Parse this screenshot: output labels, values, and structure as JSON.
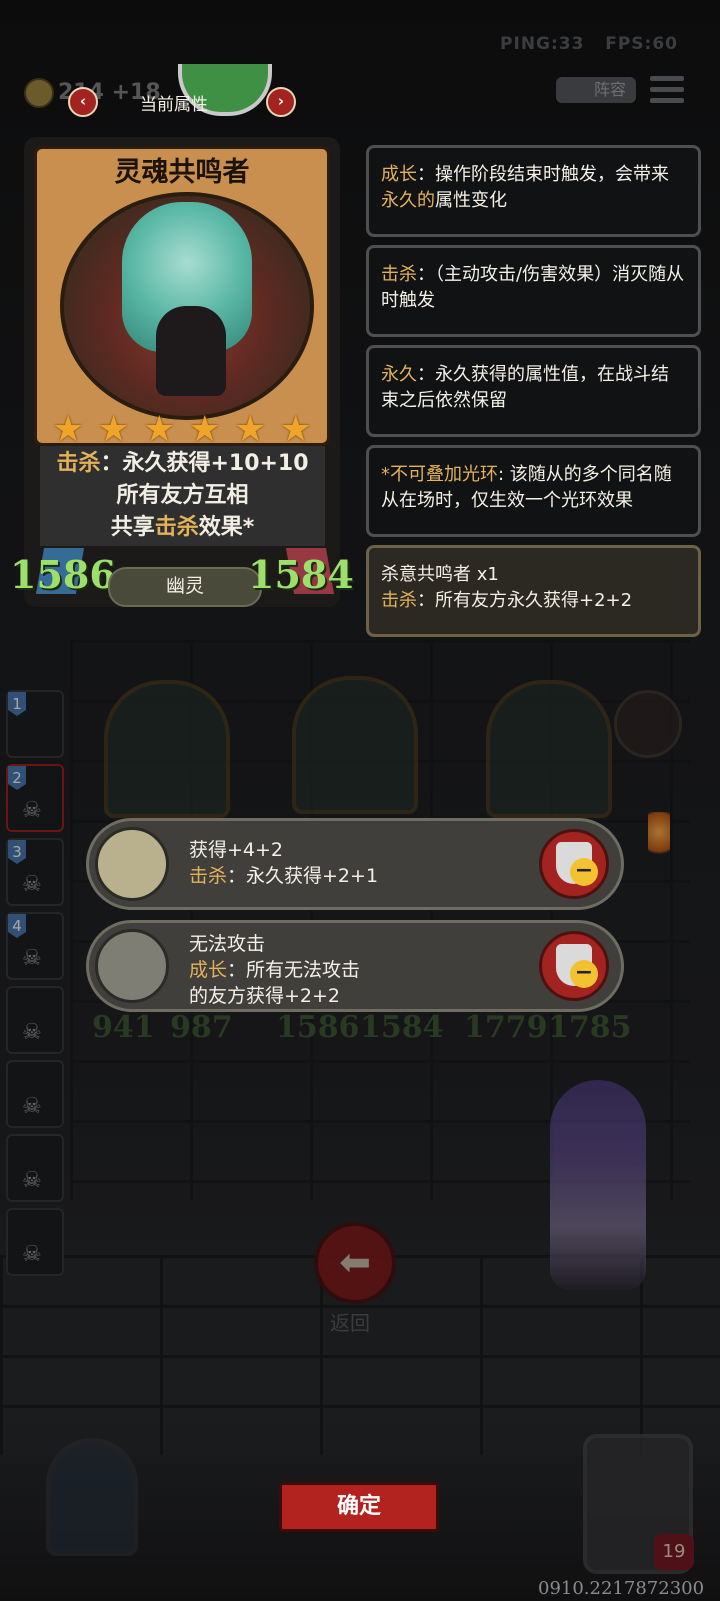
{
  "hud": {
    "ping": "PING:33",
    "fps": "FPS:60",
    "gold": "214",
    "gold_gain": "+18",
    "current_attr": "当前属性",
    "lineup_label": "阵容"
  },
  "card": {
    "name": "灵魂共鸣者",
    "stars": 6,
    "desc_line1_kw": "击杀",
    "desc_line1_rest": "：永久获得+10+10",
    "desc_line2": "所有友方互相",
    "desc_line3_pre": "共享",
    "desc_line3_kw": "击杀",
    "desc_line3_post": "效果*",
    "attack": "1586",
    "health": "1584",
    "type": "幽灵"
  },
  "tooltips": [
    {
      "kw": "成长",
      "pre": "：操作阶段结束时触发，会带来",
      "kw2": "永久的",
      "post": "属性变化"
    },
    {
      "kw": "击杀",
      "pre": "：（主动攻击/伤害效果）消灭随从时触发",
      "kw2": "",
      "post": ""
    },
    {
      "kw": "永久",
      "pre": "：永久获得的属性值，在战斗结束之后依然保留",
      "kw2": "",
      "post": ""
    },
    {
      "kw": "*不可叠加光环",
      "pre": ": 该随从的多个同名随从在场时，仅生效一个光环效果",
      "kw2": "",
      "post": ""
    }
  ],
  "bonus_tip": {
    "title": "杀意共鸣者 x1",
    "kw": "击杀",
    "text": "：所有友方永久获得+2+2"
  },
  "roster": [
    "1",
    "2",
    "3",
    "4"
  ],
  "board": {
    "row1_stats": [
      "941",
      "987",
      "1586",
      "1584",
      "1779",
      "1785"
    ]
  },
  "popups": [
    {
      "line1": "获得+4+2",
      "kw": "击杀",
      "line2": "：永久获得+2+1",
      "line3": ""
    },
    {
      "line1": "无法攻击",
      "kw": "成长",
      "line2": "：所有无法攻击",
      "line3": "的友方获得+2+2"
    }
  ],
  "bottom": {
    "back_label": "返回",
    "confirm_label": "确定",
    "uid": "0910.2217872300",
    "heart_value": "19"
  },
  "colors": {
    "keyword": "#e3b25b",
    "stat_green": "#9ce06b",
    "button_red": "#b2221e",
    "star": "#f1a42a"
  }
}
